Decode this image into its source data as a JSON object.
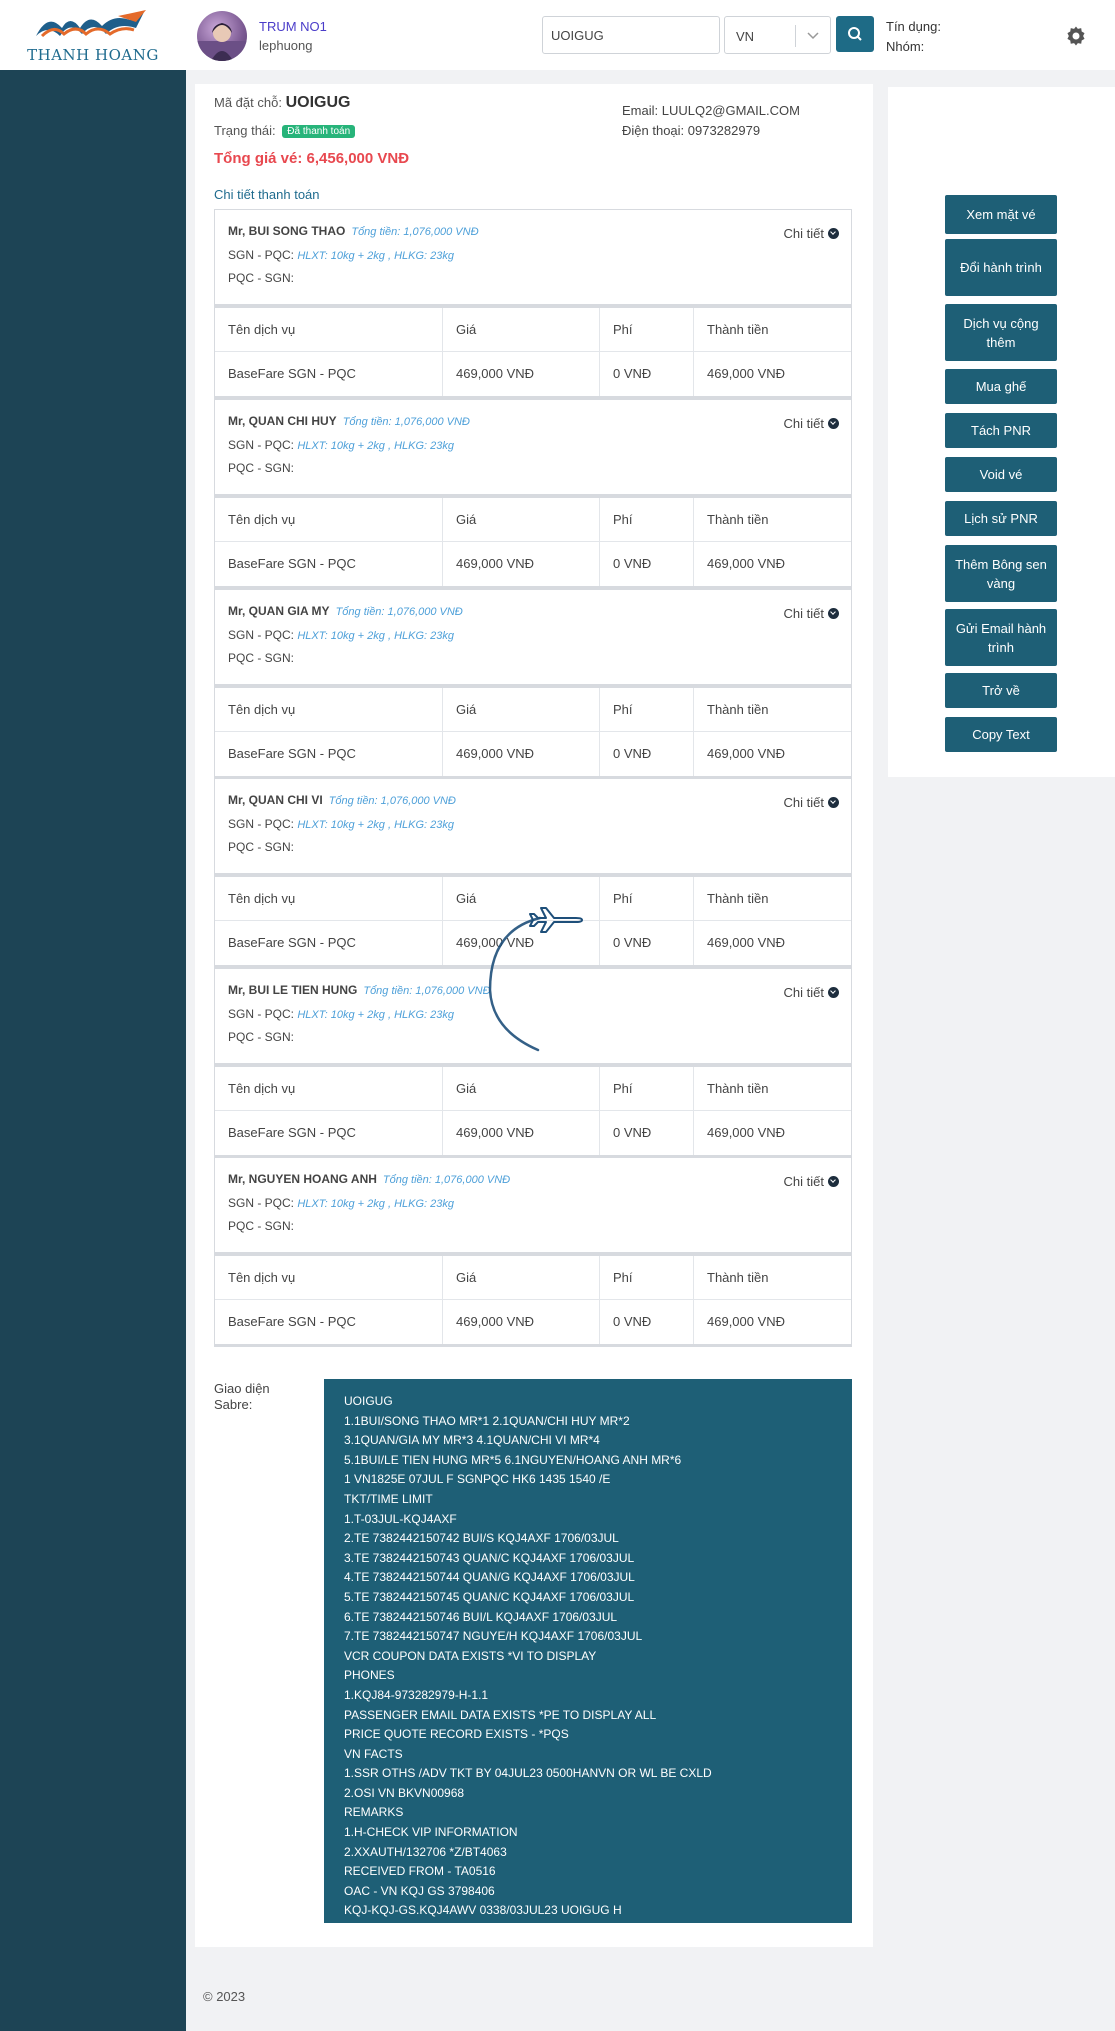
{
  "header": {
    "logo_text": "THANH HOANG",
    "user_name": "TRUM NO1",
    "user_sub": "lephuong",
    "search_value": "UOIGUG",
    "lang_value": "VN",
    "credit_label": "Tín dụng:",
    "group_label": "Nhóm:"
  },
  "booking": {
    "code_label": "Mã đặt chỗ:",
    "code": "UOIGUG",
    "status_label": "Trạng thái:",
    "status_value": "Đã thanh toán",
    "total_label": "Tổng giá vé: 6,456,000 VNĐ",
    "email": "Email: LUULQ2@GMAIL.COM",
    "phone": "Điện thoại: 0973282979",
    "payment_title": "Chi tiết thanh toán",
    "detail_label": "Chi tiết"
  },
  "table_headers": [
    "Tên dịch vụ",
    "Giá",
    "Phí",
    "Thành tiền"
  ],
  "passengers": [
    {
      "name": "Mr, BUI SONG THAO",
      "total": "Tổng tiền: 1,076,000 VNĐ",
      "route1": "SGN - PQC:",
      "bag": "HLXT: 10kg + 2kg , HLKG: 23kg",
      "route2": "PQC - SGN:",
      "service": "BaseFare SGN - PQC",
      "price": "469,000 VNĐ",
      "fee": "0 VNĐ",
      "amount": "469,000 VNĐ"
    },
    {
      "name": "Mr, QUAN CHI HUY",
      "total": "Tổng tiền: 1,076,000 VNĐ",
      "route1": "SGN - PQC:",
      "bag": "HLXT: 10kg + 2kg , HLKG: 23kg",
      "route2": "PQC - SGN:",
      "service": "BaseFare SGN - PQC",
      "price": "469,000 VNĐ",
      "fee": "0 VNĐ",
      "amount": "469,000 VNĐ"
    },
    {
      "name": "Mr, QUAN GIA MY",
      "total": "Tổng tiền: 1,076,000 VNĐ",
      "route1": "SGN - PQC:",
      "bag": "HLXT: 10kg + 2kg , HLKG: 23kg",
      "route2": "PQC - SGN:",
      "service": "BaseFare SGN - PQC",
      "price": "469,000 VNĐ",
      "fee": "0 VNĐ",
      "amount": "469,000 VNĐ"
    },
    {
      "name": "Mr, QUAN CHI VI",
      "total": "Tổng tiền: 1,076,000 VNĐ",
      "route1": "SGN - PQC:",
      "bag": "HLXT: 10kg + 2kg , HLKG: 23kg",
      "route2": "PQC - SGN:",
      "service": "BaseFare SGN - PQC",
      "price": "469,000 VNĐ",
      "fee": "0 VNĐ",
      "amount": "469,000 VNĐ"
    },
    {
      "name": "Mr, BUI LE TIEN HUNG",
      "total": "Tổng tiền: 1,076,000 VNĐ",
      "route1": "SGN - PQC:",
      "bag": "HLXT: 10kg + 2kg , HLKG: 23kg",
      "route2": "PQC - SGN:",
      "service": "BaseFare SGN - PQC",
      "price": "469,000 VNĐ",
      "fee": "0 VNĐ",
      "amount": "469,000 VNĐ"
    },
    {
      "name": "Mr, NGUYEN HOANG ANH",
      "total": "Tổng tiền: 1,076,000 VNĐ",
      "route1": "SGN - PQC:",
      "bag": "HLXT: 10kg + 2kg , HLKG: 23kg",
      "route2": "PQC - SGN:",
      "service": "BaseFare SGN - PQC",
      "price": "469,000 VNĐ",
      "fee": "0 VNĐ",
      "amount": "469,000 VNĐ"
    }
  ],
  "sabre": {
    "label": "Giao diện Sabre:",
    "lines": [
      "UOIGUG",
      "1.1BUI/SONG THAO MR*1 2.1QUAN/CHI HUY MR*2",
      "3.1QUAN/GIA MY MR*3 4.1QUAN/CHI VI MR*4",
      "5.1BUI/LE TIEN HUNG MR*5 6.1NGUYEN/HOANG ANH MR*6",
      "1 VN1825E 07JUL F SGNPQC HK6 1435 1540 /E",
      "TKT/TIME LIMIT",
      "1.T-03JUL-KQJ4AXF",
      "2.TE 7382442150742 BUI/S KQJ4AXF 1706/03JUL",
      "3.TE 7382442150743 QUAN/C KQJ4AXF 1706/03JUL",
      "4.TE 7382442150744 QUAN/G KQJ4AXF 1706/03JUL",
      "5.TE 7382442150745 QUAN/C KQJ4AXF 1706/03JUL",
      "6.TE 7382442150746 BUI/L KQJ4AXF 1706/03JUL",
      "7.TE 7382442150747 NGUYE/H KQJ4AXF 1706/03JUL",
      "VCR COUPON DATA EXISTS *VI TO DISPLAY",
      "PHONES",
      "1.KQJ84-973282979-H-1.1",
      "PASSENGER EMAIL DATA EXISTS *PE TO DISPLAY ALL",
      "PRICE QUOTE RECORD EXISTS - *PQS",
      "VN FACTS",
      "1.SSR OTHS /ADV TKT BY 04JUL23 0500HANVN OR WL BE CXLD",
      "2.OSI VN BKVN00968",
      "REMARKS",
      "1.H-CHECK VIP INFORMATION",
      "2.XXAUTH/132706 *Z/BT4063",
      "RECEIVED FROM - TA0516",
      "OAC - VN KQJ GS 3798406",
      "KQJ-KQJ-GS.KQJ4AWV 0338/03JUL23 UOIGUG H"
    ]
  },
  "actions": [
    "Xem mặt vé",
    "Đổi hành trình",
    "Dịch vụ cộng thêm",
    "Mua ghế",
    "Tách PNR",
    "Void vé",
    "Lịch sử PNR",
    "Thêm Bông sen vàng",
    "Gửi Email hành trình",
    "Trở về",
    "Copy Text"
  ],
  "footer": "© 2023",
  "colors": {
    "sidebar": "#1d4455",
    "primary": "#1e5f76",
    "accent_red": "#e8484f",
    "status_green": "#27b47a",
    "link_blue": "#1f6b8e"
  }
}
